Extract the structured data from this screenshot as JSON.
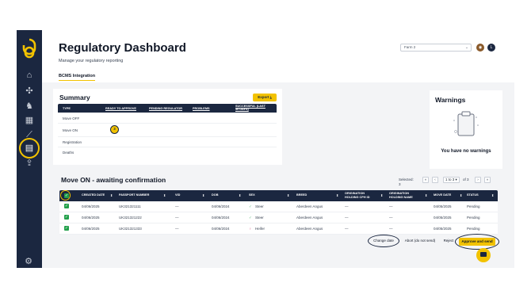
{
  "page": {
    "title": "Regulatory Dashboard",
    "subtitle": "Manage your regulatory reporting"
  },
  "header": {
    "farm_select": "Farm 2",
    "avatar_initial": "L"
  },
  "tabs": [
    {
      "label": "BCMS Integration",
      "active": true
    }
  ],
  "summary": {
    "title": "Summary",
    "export_label": "Export",
    "columns": [
      "TYPE",
      "READY TO APPROVE",
      "PENDING REGULATOR",
      "PROBLEMS",
      "SUCCESSFUL (LAST 30 DAYS)"
    ],
    "rows": [
      {
        "type": "Move OFF",
        "ready": ""
      },
      {
        "type": "Move ON",
        "ready": "3"
      },
      {
        "type": "Registration",
        "ready": ""
      },
      {
        "type": "Deaths",
        "ready": ""
      }
    ]
  },
  "warnings": {
    "title": "Warnings",
    "empty_text": "You have no warnings"
  },
  "confirmation": {
    "title": "Move ON - awaiting confirmation",
    "selected_label": "Selected:",
    "selected_count": "3",
    "pager_select": "1 to 3",
    "pager_of": "of 3",
    "columns": [
      "CREATED DATE",
      "PASSPORT NUMBER",
      "VID",
      "DOB",
      "SEX",
      "BREED",
      "ORIGINATION HOLDING CPH ID",
      "ORIGINATION HOLDING NAME",
      "MOVE DATE",
      "STATUS"
    ],
    "rows": [
      {
        "created": "04/06/2025",
        "passport": "UK321321111",
        "vid": "—",
        "dob": "04/06/2024",
        "sex": "Steer",
        "breed": "Aberdeen Angus",
        "cph": "—",
        "holding": "—",
        "move_date": "04/05/2025",
        "status": "Pending"
      },
      {
        "created": "04/06/2025",
        "passport": "UK321321222",
        "vid": "—",
        "dob": "04/06/2024",
        "sex": "Steer",
        "breed": "Aberdeen Angus",
        "cph": "—",
        "holding": "—",
        "move_date": "04/05/2025",
        "status": "Pending"
      },
      {
        "created": "04/06/2025",
        "passport": "UK321321333",
        "vid": "—",
        "dob": "04/06/2024",
        "sex": "Heifer",
        "breed": "Aberdeen Angus",
        "cph": "—",
        "holding": "—",
        "move_date": "04/05/2025",
        "status": "Pending"
      }
    ],
    "actions": {
      "change_date": "Change date",
      "abort": "Abort (do not send)",
      "reject": "Reject",
      "approve": "Approve and send"
    }
  },
  "colors": {
    "sidebar": "#1b2740",
    "accent": "#f2c200",
    "table_head": "#1b2740",
    "check": "#22a04b",
    "avatar_brown": "#8a5a2b",
    "avatar_dark": "#1b2740"
  }
}
